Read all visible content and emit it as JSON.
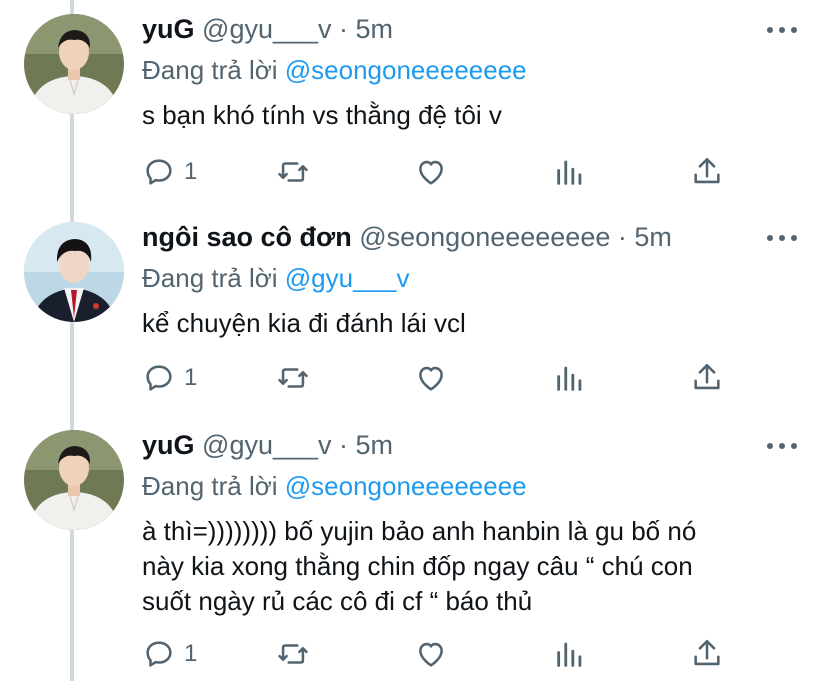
{
  "tweets": [
    {
      "name": "yuG",
      "handle": "@gyu___v",
      "sep": " · ",
      "time": "5m",
      "reply_prefix": "Đang trả lời ",
      "reply_to": "@seongoneeeeeeee",
      "text": "s bạn khó tính vs thằng đệ tôi v",
      "reply_count": "1",
      "avatar": "avatar-white-shirt"
    },
    {
      "name": "ngôi sao cô đơn",
      "handle": "@seongoneeeeeeee",
      "sep": " · ",
      "time": "5m",
      "reply_prefix": "Đang trả lời ",
      "reply_to": "@gyu___v",
      "text": "kể chuyện kia đi đánh lái vcl",
      "reply_count": "1",
      "avatar": "avatar-school-uniform"
    },
    {
      "name": "yuG",
      "handle": "@gyu___v",
      "sep": " · ",
      "time": "5m",
      "reply_prefix": "Đang trả lời ",
      "reply_to": "@seongoneeeeeeee",
      "text": "à thì=)))))))) bố yujin bảo anh hanbin là gu bố nó\nnày kia xong thằng chin đốp ngay câu “ chú con\nsuốt ngày rủ các cô đi cf “ báo thủ",
      "reply_count": "1",
      "avatar": "avatar-white-shirt"
    }
  ],
  "colors": {
    "mention": "#1d9bf0",
    "muted": "#536471",
    "thread_line": "#cfd9de"
  },
  "icons": [
    "reply-icon",
    "retweet-icon",
    "like-icon",
    "analytics-icon",
    "share-icon",
    "more-icon"
  ]
}
